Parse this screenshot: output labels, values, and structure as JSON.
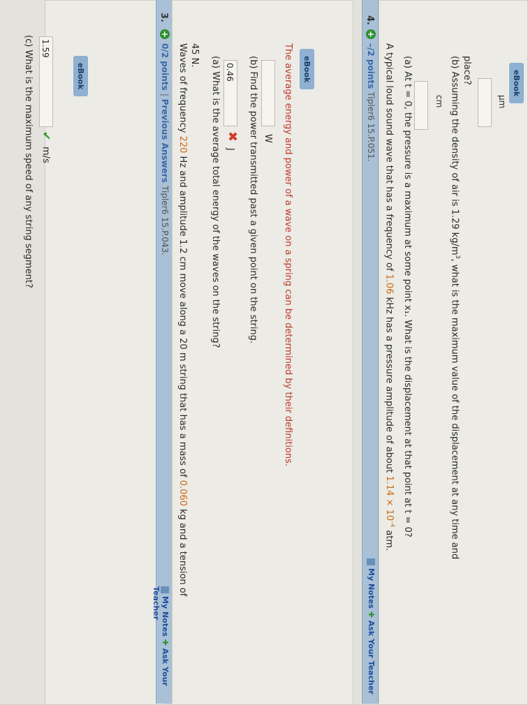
{
  "q2": {
    "c_prompt": "(c) What is the maximum speed of any string segment?",
    "c_value": "1.59",
    "c_unit": "m/s",
    "ebook": "eBook"
  },
  "q3": {
    "number": "3.",
    "points": "0/2 points",
    "prev_answers": "Previous Answers",
    "source": "Tipler6 15.P.043.",
    "my_notes": "My Notes",
    "ask_teacher": "Ask Your Teacher",
    "stmt_1": "Waves of frequency ",
    "freq": "220",
    "stmt_2": " Hz and amplitude 1.2 cm move along a 20 m string that has a mass of ",
    "mass": "0.060",
    "stmt_3": " kg and a tension of",
    "stmt_4": "45 N.",
    "a_prompt": "(a) What is the average total energy of the waves on the string?",
    "a_value": "0.46",
    "a_unit": "J",
    "b_prompt": "(b) Find the power transmitted past a given point on the string.",
    "b_unit": "W",
    "feedback": "The average energy and power of a wave on a spring can be determined by their definitions.",
    "ebook": "eBook"
  },
  "q4": {
    "number": "4.",
    "points": "–/2 points",
    "source": "Tipler6 15.P.051.",
    "my_notes": "My Notes",
    "ask_teacher": "Ask Your Teacher",
    "stmt_1": "A typical loud sound wave that has a frequency of ",
    "freq": "1.06",
    "stmt_2": " kHz has a pressure amplitude of about ",
    "pressure": "1.14 × 10",
    "pressure_exp": "–4",
    "stmt_3": " atm.",
    "a_prompt": "(a) At t = 0, the pressure is a maximum at some point x₁. What is the displacement at that point at t = 0?",
    "a_unit": "cm",
    "b_prompt_1": "(b) Assuming the density of air is 1.29 kg/m",
    "b_sup": "3",
    "b_prompt_2": ", what is the maximum value of the displacement at any time and",
    "b_prompt_3": "place?",
    "b_unit": "µm",
    "ebook": "eBook"
  }
}
